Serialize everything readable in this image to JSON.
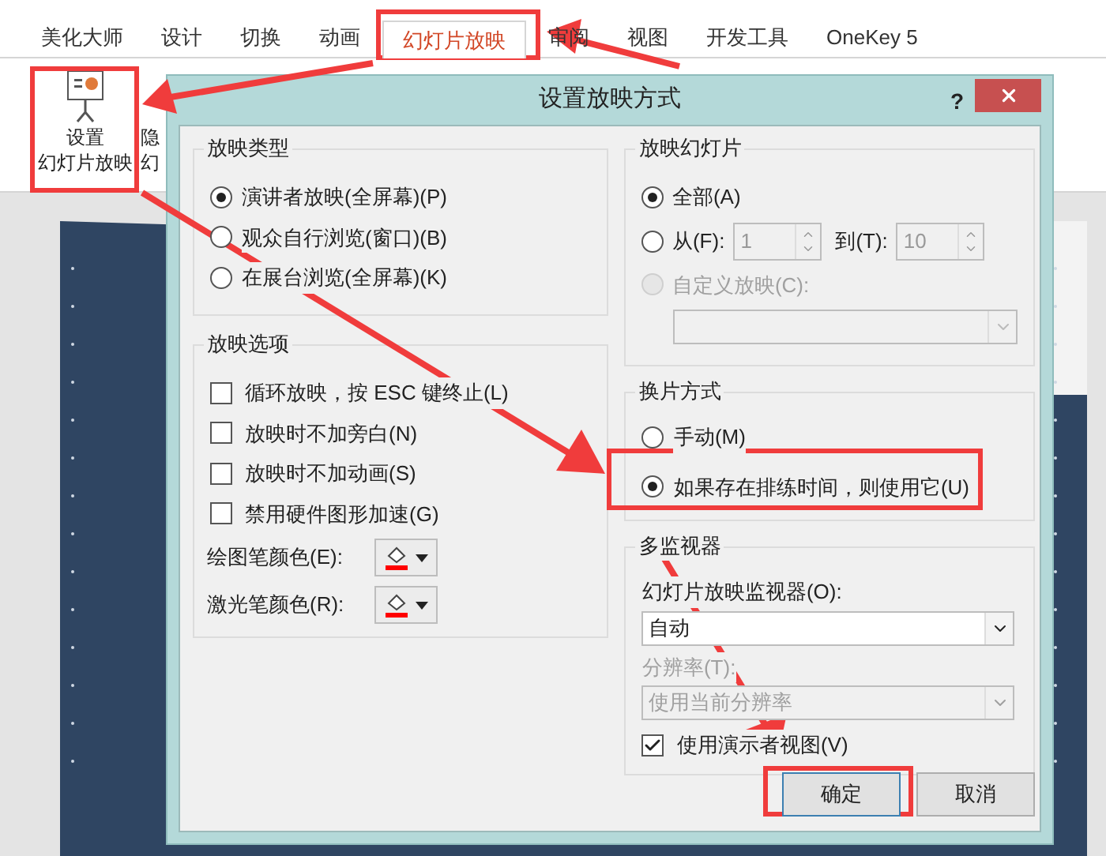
{
  "ribbon": {
    "tabs": [
      {
        "label": "美化大师",
        "selected": false
      },
      {
        "label": "设计",
        "selected": false
      },
      {
        "label": "切换",
        "selected": false
      },
      {
        "label": "动画",
        "selected": false
      },
      {
        "label": "幻灯片放映",
        "selected": true
      },
      {
        "label": "审阅",
        "selected": false
      },
      {
        "label": "视图",
        "selected": false
      },
      {
        "label": "开发工具",
        "selected": false
      },
      {
        "label": "OneKey 5",
        "selected": false
      }
    ],
    "buttons": [
      {
        "kind": "setup",
        "lines": [
          "设置",
          "幻灯片放映"
        ]
      },
      {
        "kind": "partial",
        "lines": [
          "隐",
          "幻"
        ]
      }
    ]
  },
  "dialog": {
    "title": "设置放映方式",
    "help": "?",
    "show_type": {
      "title": "放映类型",
      "options": [
        {
          "label": "演讲者放映(全屏幕)(P)",
          "selected": true
        },
        {
          "label": "观众自行浏览(窗口)(B)",
          "selected": false
        },
        {
          "label": "在展台浏览(全屏幕)(K)",
          "selected": false
        }
      ]
    },
    "show_options": {
      "title": "放映选项",
      "checkboxes": [
        {
          "label": "循环放映，按 ESC 键终止(L)",
          "checked": false
        },
        {
          "label": "放映时不加旁白(N)",
          "checked": false
        },
        {
          "label": "放映时不加动画(S)",
          "checked": false
        },
        {
          "label": "禁用硬件图形加速(G)",
          "checked": false
        }
      ],
      "pens": [
        {
          "label": "绘图笔颜色(E):"
        },
        {
          "label": "激光笔颜色(R):"
        }
      ]
    },
    "slides": {
      "title": "放映幻灯片",
      "options": [
        {
          "kind": "all",
          "label": "全部(A)",
          "selected": true,
          "disabled": false
        },
        {
          "kind": "range",
          "label": "从(F):",
          "from": "1",
          "to_label": "到(T):",
          "to": "10",
          "selected": false,
          "disabled": false
        },
        {
          "kind": "custom",
          "label": "自定义放映(C):",
          "selected": false,
          "disabled": true
        }
      ]
    },
    "advance": {
      "title": "换片方式",
      "options": [
        {
          "label": "手动(M)",
          "selected": false
        },
        {
          "label": "如果存在排练时间，则使用它(U)",
          "selected": true
        }
      ]
    },
    "monitors": {
      "title": "多监视器",
      "monitor_label": "幻灯片放映监视器(O):",
      "monitor_value": "自动",
      "resolution_label": "分辨率(T):",
      "resolution_value": "使用当前分辨率",
      "presenter_view": {
        "label": "使用演示者视图(V)",
        "checked": true
      }
    },
    "buttons": [
      {
        "label": "确定",
        "default": true
      },
      {
        "label": "取消",
        "default": false
      }
    ]
  }
}
